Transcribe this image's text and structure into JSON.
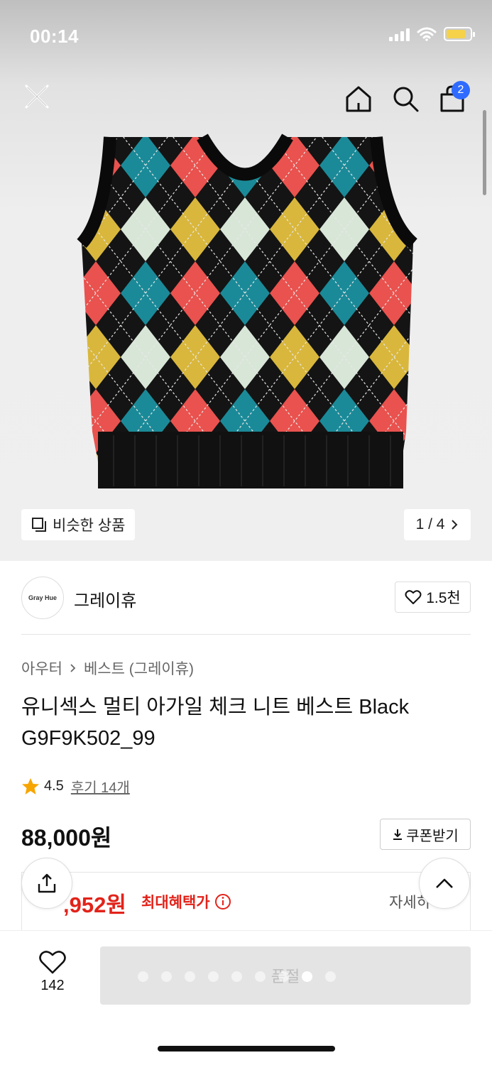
{
  "status_bar": {
    "time": "00:14"
  },
  "nav": {
    "close_icon": "close-icon",
    "home_icon": "home-icon",
    "search_icon": "search-icon",
    "cart_icon": "shopping-bag-icon",
    "cart_count": "2"
  },
  "gallery": {
    "similar_label": "비슷한 상품",
    "counter": "1 / 4"
  },
  "brand": {
    "logo_text": "Gray Hue",
    "name": "그레이휴",
    "likes": "1.5천"
  },
  "breadcrumb": {
    "category": "아우터",
    "subcategory": "베스트 (그레이휴)"
  },
  "product": {
    "title": "유니섹스 멀티 아가일 체크 니트 베스트 Black G9F9K502_99",
    "rating": "4.5",
    "reviews": "후기 14개",
    "price": "88,000원",
    "coupon_label": "쿠폰받기"
  },
  "benefit": {
    "price": ",952원",
    "label": "최대혜택가",
    "detail": "자세히"
  },
  "bottom_bar": {
    "wish_count": "142",
    "soldout_label": "품절"
  },
  "colors": {
    "accent_red": "#e2231a",
    "badge_blue": "#2f6bff"
  }
}
